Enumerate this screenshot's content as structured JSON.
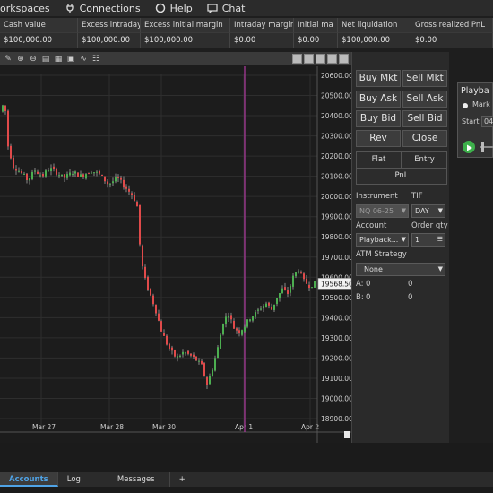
{
  "menu": [
    {
      "label": "orkspaces",
      "icon": "none"
    },
    {
      "label": "Connections",
      "icon": "plug-icon"
    },
    {
      "label": "Help",
      "icon": "help-circle-icon"
    },
    {
      "label": "Chat",
      "icon": "chat-icon"
    }
  ],
  "accounts_grid": {
    "columns": [
      "Cash value",
      "Excess intraday m",
      "Excess initial margin",
      "Intraday margin",
      "Initial ma",
      "Net liquidation",
      "Gross realized PnL"
    ],
    "values": [
      "$100,000.00",
      "$100,000.00",
      "$100,000.00",
      "$0.00",
      "$0.00",
      "$100,000.00",
      "$0.00"
    ]
  },
  "chart": {
    "price_label": "19568.50",
    "y_ticks": [
      "20600.00",
      "20500.00",
      "20400.00",
      "20300.00",
      "20200.00",
      "20100.00",
      "20000.00",
      "19900.00",
      "19800.00",
      "19700.00",
      "19600.00",
      "19500.00",
      "19400.00",
      "19300.00",
      "19200.00",
      "19100.00",
      "19000.00",
      "18900.00"
    ],
    "x_ticks": [
      "Mar 27",
      "Mar 28",
      "Mar 30",
      "Apr 1",
      "Apr 2"
    ]
  },
  "chart_data": {
    "type": "candlestick",
    "ylim": [
      18900,
      20600
    ],
    "x": [
      "Mar 27",
      "Mar 28",
      "Mar 30",
      "Apr 1",
      "Apr 2"
    ],
    "last_price": 19568.5,
    "colors": {
      "up": "#4caf50",
      "down": "#e04a4a",
      "background": "#1c1c1c",
      "grid": "#2e2e2e",
      "session_line": "#b03aa0"
    }
  },
  "trade_panel": {
    "buy_mkt": "Buy Mkt",
    "sell_mkt": "Sell Mkt",
    "buy_ask": "Buy Ask",
    "sell_ask": "Sell Ask",
    "buy_bid": "Buy Bid",
    "sell_bid": "Sell Bid",
    "rev": "Rev",
    "close": "Close",
    "flat": "Flat",
    "entry": "Entry",
    "pnl": "PnL",
    "instrument_label": "Instrument",
    "tif_label": "TIF",
    "instrument_value": "NQ 06-25",
    "tif_value": "DAY",
    "account_label": "Account",
    "order_qty_label": "Order qty",
    "account_value": "Playback...",
    "order_qty_value": "1",
    "atm_label": "ATM Strategy",
    "atm_value": "None",
    "a_label": "A:",
    "a_left": "0",
    "a_right": "0",
    "b_label": "B:",
    "b_left": "0",
    "b_right": "0"
  },
  "playback": {
    "title": "Playba",
    "market_label": "Mark",
    "start_label": "Start",
    "start_value": "04"
  },
  "bottom_tabs": [
    "Accounts",
    "Log",
    "Messages",
    "+"
  ]
}
